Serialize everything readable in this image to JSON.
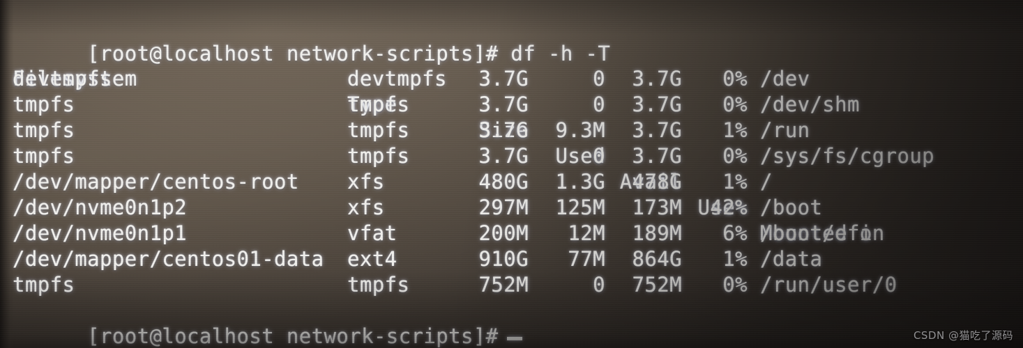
{
  "terminal": {
    "command_line": "[root@localhost network-scripts]# df -h -T",
    "prompt": "[root@localhost network-scripts]#",
    "cursor": "_",
    "headers": {
      "filesystem": "Filesystem",
      "type": "Type",
      "size": "Size",
      "used": "Used",
      "avail": "Avail",
      "use_pct": "Use%",
      "mounted": "Mounted on"
    },
    "rows": [
      {
        "filesystem": "devtmpfs",
        "type": "devtmpfs",
        "size": "3.7G",
        "used": "0",
        "avail": "3.7G",
        "use_pct": "0%",
        "mounted": "/dev"
      },
      {
        "filesystem": "tmpfs",
        "type": "tmpfs",
        "size": "3.7G",
        "used": "0",
        "avail": "3.7G",
        "use_pct": "0%",
        "mounted": "/dev/shm"
      },
      {
        "filesystem": "tmpfs",
        "type": "tmpfs",
        "size": "3.7G",
        "used": "9.3M",
        "avail": "3.7G",
        "use_pct": "1%",
        "mounted": "/run"
      },
      {
        "filesystem": "tmpfs",
        "type": "tmpfs",
        "size": "3.7G",
        "used": "0",
        "avail": "3.7G",
        "use_pct": "0%",
        "mounted": "/sys/fs/cgroup"
      },
      {
        "filesystem": "/dev/mapper/centos-root",
        "type": "xfs",
        "size": "480G",
        "used": "1.3G",
        "avail": "478G",
        "use_pct": "1%",
        "mounted": "/"
      },
      {
        "filesystem": "/dev/nvme0n1p2",
        "type": "xfs",
        "size": "297M",
        "used": "125M",
        "avail": "173M",
        "use_pct": "42%",
        "mounted": "/boot"
      },
      {
        "filesystem": "/dev/nvme0n1p1",
        "type": "vfat",
        "size": "200M",
        "used": "12M",
        "avail": "189M",
        "use_pct": "6%",
        "mounted": "/boot/efi"
      },
      {
        "filesystem": "/dev/mapper/centos01-data",
        "type": "ext4",
        "size": "910G",
        "used": "77M",
        "avail": "864G",
        "use_pct": "1%",
        "mounted": "/data"
      },
      {
        "filesystem": "tmpfs",
        "type": "tmpfs",
        "size": "752M",
        "used": "0",
        "avail": "752M",
        "use_pct": "0%",
        "mounted": "/run/user/0"
      }
    ]
  },
  "watermark": "CSDN @猫吃了源码",
  "colors": {
    "text": "#f2f1ee",
    "background_dark": "#2a2522",
    "background_warm": "#6b6056"
  }
}
